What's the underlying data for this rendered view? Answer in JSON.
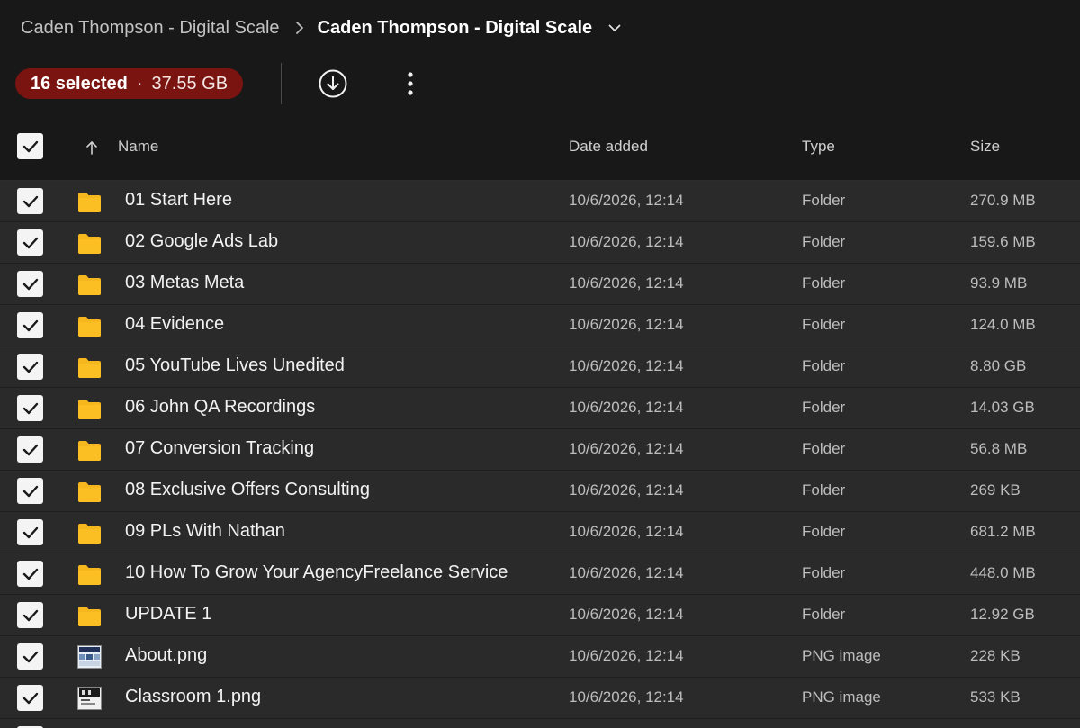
{
  "breadcrumb": {
    "parent": "Caden Thompson - Digital Scale",
    "current": "Caden Thompson - Digital Scale"
  },
  "toolbar": {
    "selected_count": "16 selected",
    "separator": "·",
    "selected_size": "37.55 GB",
    "download_icon": "download-circle-icon",
    "more_icon": "more-vertical-icon"
  },
  "table": {
    "columns": {
      "name": "Name",
      "date_added": "Date added",
      "type": "Type",
      "size": "Size"
    },
    "sort_icon": "arrow-up-icon",
    "rows": [
      {
        "name": "01 Start Here",
        "date": "10/6/2026, 12:14",
        "type": "Folder",
        "size": "270.9 MB",
        "icon": "folder-icon",
        "checked": true
      },
      {
        "name": "02 Google Ads Lab",
        "date": "10/6/2026, 12:14",
        "type": "Folder",
        "size": "159.6 MB",
        "icon": "folder-icon",
        "checked": true
      },
      {
        "name": "03 Metas Meta",
        "date": "10/6/2026, 12:14",
        "type": "Folder",
        "size": "93.9 MB",
        "icon": "folder-icon",
        "checked": true
      },
      {
        "name": "04 Evidence",
        "date": "10/6/2026, 12:14",
        "type": "Folder",
        "size": "124.0 MB",
        "icon": "folder-icon",
        "checked": true
      },
      {
        "name": "05 YouTube Lives Unedited",
        "date": "10/6/2026, 12:14",
        "type": "Folder",
        "size": "8.80 GB",
        "icon": "folder-icon",
        "checked": true
      },
      {
        "name": "06 John QA Recordings",
        "date": "10/6/2026, 12:14",
        "type": "Folder",
        "size": "14.03 GB",
        "icon": "folder-icon",
        "checked": true
      },
      {
        "name": "07 Conversion Tracking",
        "date": "10/6/2026, 12:14",
        "type": "Folder",
        "size": "56.8 MB",
        "icon": "folder-icon",
        "checked": true
      },
      {
        "name": "08 Exclusive Offers Consulting",
        "date": "10/6/2026, 12:14",
        "type": "Folder",
        "size": "269 KB",
        "icon": "folder-icon",
        "checked": true
      },
      {
        "name": "09 PLs With Nathan",
        "date": "10/6/2026, 12:14",
        "type": "Folder",
        "size": "681.2 MB",
        "icon": "folder-icon",
        "checked": true
      },
      {
        "name": "10 How To Grow Your AgencyFreelance Service",
        "date": "10/6/2026, 12:14",
        "type": "Folder",
        "size": "448.0 MB",
        "icon": "folder-icon",
        "checked": true
      },
      {
        "name": "UPDATE 1",
        "date": "10/6/2026, 12:14",
        "type": "Folder",
        "size": "12.92 GB",
        "icon": "folder-icon",
        "checked": true
      },
      {
        "name": "About.png",
        "date": "10/6/2026, 12:14",
        "type": "PNG image",
        "size": "228 KB",
        "icon": "image-thumbnail-icon",
        "checked": true
      },
      {
        "name": "Classroom 1.png",
        "date": "10/6/2026, 12:14",
        "type": "PNG image",
        "size": "533 KB",
        "icon": "image-thumbnail-icon",
        "checked": true
      }
    ]
  },
  "colors": {
    "background": "#181818",
    "row_background": "#2a2a2b",
    "selection_pill": "#7a1410",
    "folder": "#f6b61d",
    "checkbox": "#f4f4f4"
  }
}
